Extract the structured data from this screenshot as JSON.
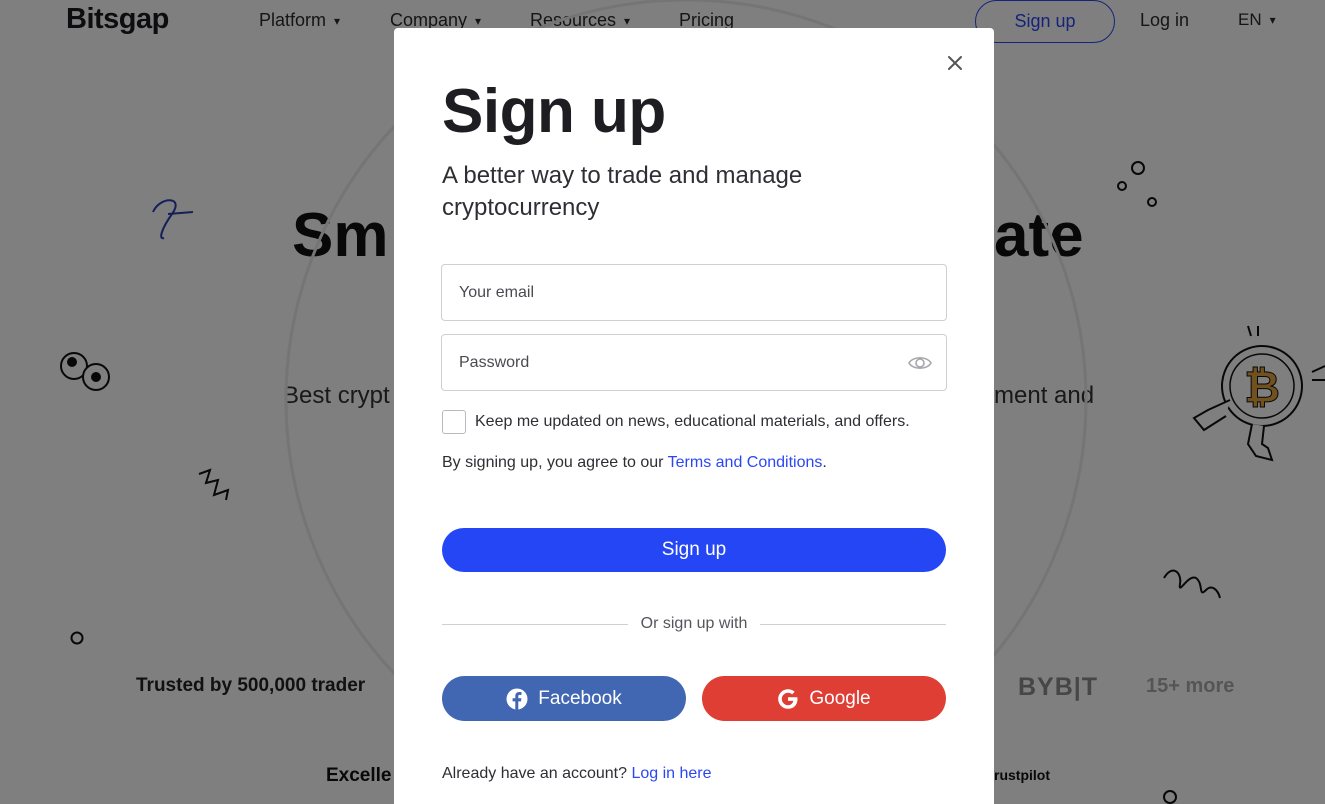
{
  "nav": {
    "logo": "Bitsgap",
    "items": [
      {
        "label": "Platform",
        "chevron": "▾"
      },
      {
        "label": "Company",
        "chevron": "▾"
      },
      {
        "label": "Resources",
        "chevron": "▾"
      },
      {
        "label": "Pricing"
      }
    ],
    "signup_label": "Sign up",
    "login_label": "Log in",
    "language": "EN"
  },
  "hero": {
    "headline_left": "Sm",
    "headline_right": "ate",
    "sub_left": "Best crypt",
    "sub_right": "ment and"
  },
  "partners": {
    "trusted_text": "Trusted by 500,000 trader",
    "bybit": "BYB|T",
    "more": "15+ more"
  },
  "reviews": {
    "excellent": "Excelle",
    "trustpilot": "rustpilot"
  },
  "modal": {
    "title": "Sign up",
    "subtitle": "A better way to trade and manage cryptocurrency",
    "email_placeholder": "Your email",
    "password_placeholder": "Password",
    "newsletter_label": "Keep me updated on news, educational materials, and offers.",
    "newsletter_checked": false,
    "terms_prefix": "By signing up, you agree to our ",
    "terms_link": "Terms and Conditions",
    "terms_suffix": ".",
    "submit_label": "Sign up",
    "divider_text": "Or sign up with",
    "facebook_label": "Facebook",
    "google_label": "Google",
    "already_text": "Already have an account? ",
    "login_link": "Log in here"
  },
  "colors": {
    "primary": "#2446f5",
    "facebook": "#4267b2",
    "google": "#df3e35",
    "link": "#2b47f5",
    "overlay": "rgba(0,0,0,0.5)"
  },
  "icons": {
    "close": "close-icon",
    "password_visibility": "eye-icon",
    "facebook": "facebook-icon",
    "google": "google-icon",
    "nav_chevron": "chevron-down-icon"
  }
}
